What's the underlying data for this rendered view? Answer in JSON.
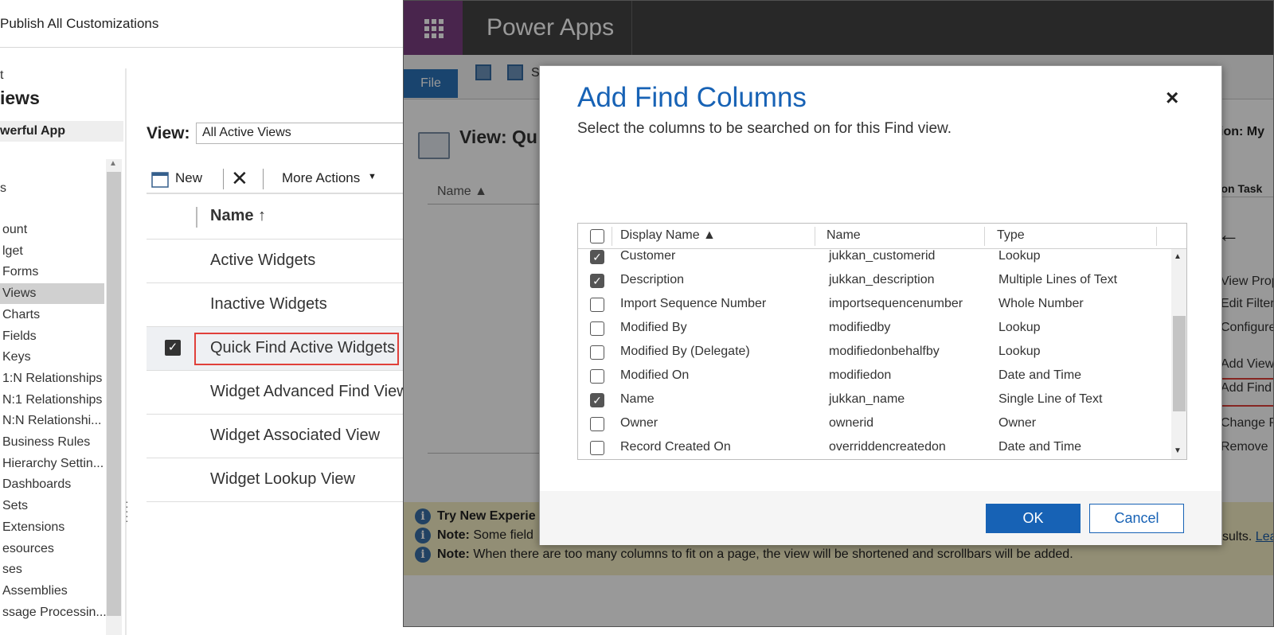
{
  "topbar": {
    "publish_all": "Publish All Customizations"
  },
  "left_nav": {
    "crumb": "t",
    "section_title": "iews",
    "solution_name": "werful App",
    "group_label": "s",
    "items": [
      {
        "label": "ount"
      },
      {
        "label": "lget"
      },
      {
        "label": "Forms"
      },
      {
        "label": "Views"
      },
      {
        "label": "Charts"
      },
      {
        "label": "Fields"
      },
      {
        "label": "Keys"
      },
      {
        "label": "1:N Relationships"
      },
      {
        "label": "N:1 Relationships"
      },
      {
        "label": "N:N Relationshi..."
      },
      {
        "label": "Business Rules"
      },
      {
        "label": "Hierarchy Settin..."
      },
      {
        "label": "Dashboards"
      },
      {
        "label": "Sets"
      },
      {
        "label": "Extensions"
      },
      {
        "label": "esources"
      },
      {
        "label": "ses"
      },
      {
        "label": "Assemblies"
      },
      {
        "label": "ssage Processin..."
      }
    ]
  },
  "views_panel": {
    "view_label": "View:",
    "view_selected": "All Active Views",
    "toolbar": {
      "new": "New",
      "more_actions": "More Actions"
    },
    "column_header": "Name ↑",
    "rows": [
      {
        "label": "Active Widgets"
      },
      {
        "label": "Inactive Widgets"
      },
      {
        "label": "Quick Find Active Widgets"
      },
      {
        "label": "Widget Advanced Find View"
      },
      {
        "label": "Widget Associated View"
      },
      {
        "label": "Widget Lookup View"
      }
    ]
  },
  "power_apps": {
    "title": "Power Apps",
    "file_tab": "File",
    "save_partial": "S",
    "view_title": "View: Qu",
    "solution_partial": "ion: My",
    "name_column": "Name ▲",
    "tasks_title": "mon Task",
    "tasks": [
      {
        "label": "View Prop"
      },
      {
        "label": "Edit Filter"
      },
      {
        "label": "Configure"
      },
      {
        "label": "Add View"
      },
      {
        "label": "Add Find"
      },
      {
        "label": "Change P"
      },
      {
        "label": "Remove"
      }
    ],
    "notices": {
      "n1_bold": "Try New Experie",
      "n2_bold": "Note:",
      "n2_text": "Some field",
      "n3_bold": "Note:",
      "n3_text": "When there are too many columns to fit on a page, the view will be shortened and scrollbars will be added.",
      "right_text": "sults.",
      "right_link": "Lea"
    }
  },
  "dialog": {
    "title": "Add Find Columns",
    "subtitle": "Select the columns to be searched on for this Find view.",
    "close": "×",
    "headers": {
      "display_name": "Display Name ▲",
      "name": "Name",
      "type": "Type"
    },
    "rows": [
      {
        "display": "Customer",
        "name": "jukkan_customerid",
        "type": "Lookup",
        "checked": true
      },
      {
        "display": "Description",
        "name": "jukkan_description",
        "type": "Multiple Lines of Text",
        "checked": true
      },
      {
        "display": "Import Sequence Number",
        "name": "importsequencenumber",
        "type": "Whole Number",
        "checked": false
      },
      {
        "display": "Modified By",
        "name": "modifiedby",
        "type": "Lookup",
        "checked": false
      },
      {
        "display": "Modified By (Delegate)",
        "name": "modifiedonbehalfby",
        "type": "Lookup",
        "checked": false
      },
      {
        "display": "Modified On",
        "name": "modifiedon",
        "type": "Date and Time",
        "checked": false
      },
      {
        "display": "Name",
        "name": "jukkan_name",
        "type": "Single Line of Text",
        "checked": true
      },
      {
        "display": "Owner",
        "name": "ownerid",
        "type": "Owner",
        "checked": false
      },
      {
        "display": "Record Created On",
        "name": "overriddencreatedon",
        "type": "Date and Time",
        "checked": false
      }
    ],
    "ok": "OK",
    "cancel": "Cancel"
  },
  "colors": {
    "accent": "#1762b5",
    "waffle": "#7b3f80",
    "highlight": "#e0403a",
    "notice": "#f4edc4"
  }
}
